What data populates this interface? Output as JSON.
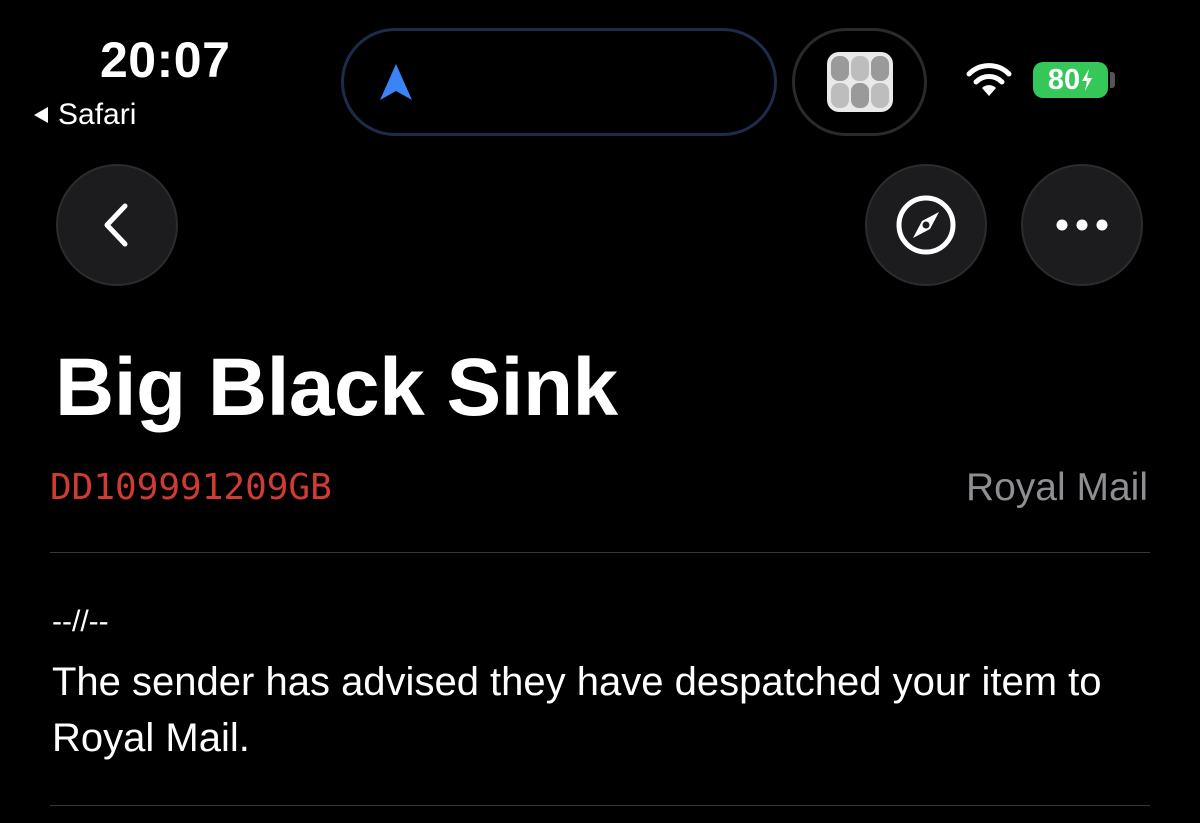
{
  "status_bar": {
    "time": "20:07",
    "back_app_label": "Safari",
    "battery_percent": "80",
    "icons": [
      "navigation-arrow-icon",
      "wifi-icon",
      "battery-charging-icon"
    ]
  },
  "nav": {
    "icons": [
      "chevron-left-icon",
      "compass-icon",
      "ellipsis-icon"
    ]
  },
  "package": {
    "title": "Big Black Sink",
    "tracking_number": "DD109991209GB",
    "carrier": "Royal Mail"
  },
  "events": [
    {
      "separator": "--//--",
      "message": "The sender has advised they have despatched your item to Royal Mail."
    }
  ],
  "colors": {
    "background": "#000000",
    "tracking_number": "#d03b33",
    "carrier": "#8e8e93",
    "battery": "#36c759",
    "button_bg": "#1c1c1e",
    "island_accent": "#3478f6"
  }
}
